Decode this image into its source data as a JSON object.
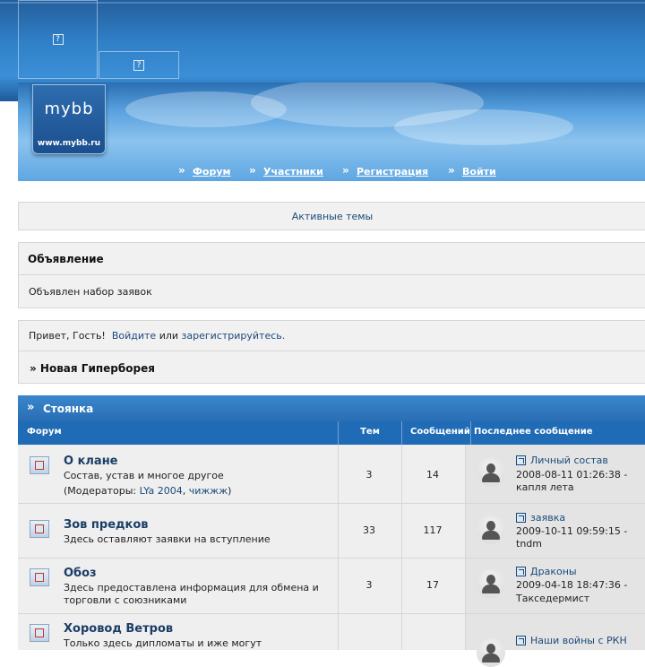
{
  "header": {
    "logo_text": "mybb",
    "logo_url": "www.mybb.ru",
    "nav": [
      {
        "label": "Форум"
      },
      {
        "label": "Участники"
      },
      {
        "label": "Регистрация"
      },
      {
        "label": "Войти"
      }
    ]
  },
  "active_topics": {
    "label": "Активные темы"
  },
  "announcement": {
    "title": "Объявление",
    "body": "Объявлен набор заявок"
  },
  "welcome": {
    "greeting": "Привет, Гость!",
    "login_link": "Войдите",
    "or_text": "или",
    "register_link": "зарегистрируйтесь.",
    "breadcrumb": "» Новая Гиперборея"
  },
  "category": {
    "name": "Стоянка",
    "columns": {
      "forum": "Форум",
      "topics": "Тем",
      "posts": "Сообщений",
      "last_post": "Последнее сообщение"
    }
  },
  "forums": [
    {
      "name": "О клане",
      "desc": "Состав, устав и многое другое",
      "mods_prefix": "(Модераторы:",
      "mods": [
        "LYa 2004",
        "чижжж"
      ],
      "mods_suffix": ")",
      "topics": "3",
      "posts": "14",
      "last_title": "Личный состав",
      "last_date": "2008-08-11 01:26:38 -",
      "last_author": "капля лета"
    },
    {
      "name": "Зов предков",
      "desc": "Здесь оставляют заявки на вступление",
      "topics": "33",
      "posts": "117",
      "last_title": "заявка",
      "last_date": "2009-10-11 09:59:15 -",
      "last_author": "tndm"
    },
    {
      "name": "Обоз",
      "desc_line1": "Здесь предоставлена информация для обмена и",
      "desc_line2": "торговли с союзниками",
      "topics": "3",
      "posts": "17",
      "last_title": "Драконы",
      "last_date": "2009-04-18 18:47:36 -",
      "last_author": "Такседермист"
    },
    {
      "name": "Хоровод Ветров",
      "desc": "Только здесь дипломаты и иже могут",
      "last_title": "Наши войны с РКН"
    }
  ],
  "colors": {
    "header_blue": "#2f7fc6",
    "table_head": "#1f6bb5",
    "link": "#1a4a7a",
    "row_bg": "#efefef"
  }
}
